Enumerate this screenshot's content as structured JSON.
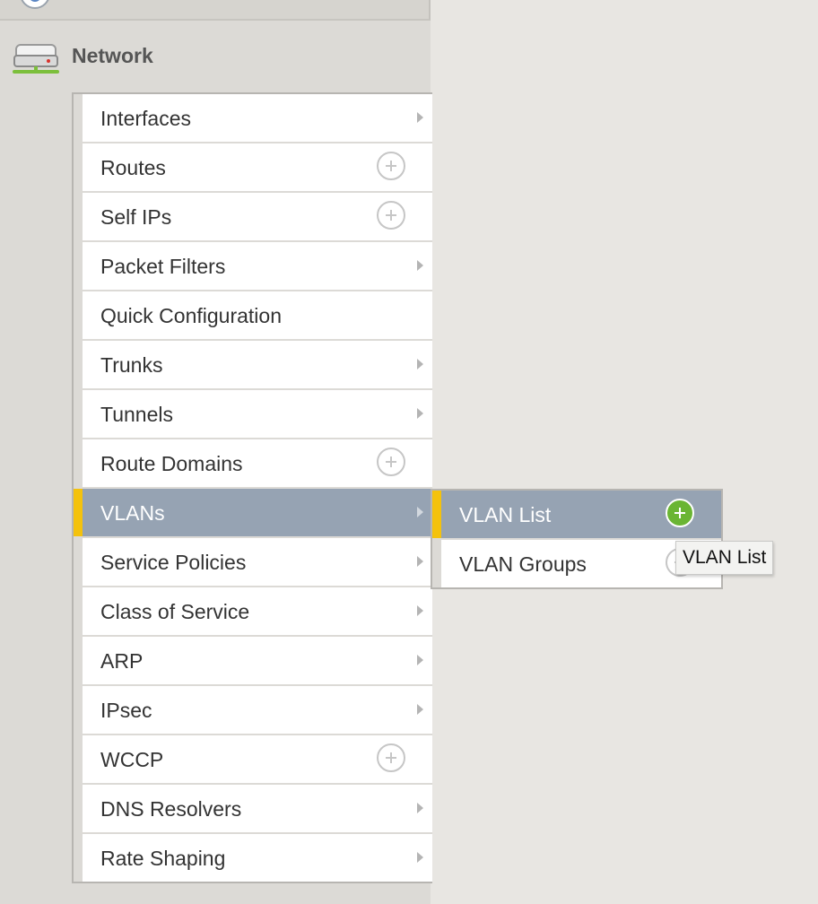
{
  "header": {
    "title": "Network",
    "icon": "network-device-icon"
  },
  "menu": {
    "items": [
      {
        "label": "Interfaces",
        "affordance": "arrow"
      },
      {
        "label": "Routes",
        "affordance": "plus"
      },
      {
        "label": "Self IPs",
        "affordance": "plus"
      },
      {
        "label": "Packet Filters",
        "affordance": "arrow"
      },
      {
        "label": "Quick Configuration",
        "affordance": "none"
      },
      {
        "label": "Trunks",
        "affordance": "arrow"
      },
      {
        "label": "Tunnels",
        "affordance": "arrow"
      },
      {
        "label": "Route Domains",
        "affordance": "plus"
      },
      {
        "label": "VLANs",
        "affordance": "arrow",
        "selected": true
      },
      {
        "label": "Service Policies",
        "affordance": "arrow"
      },
      {
        "label": "Class of Service",
        "affordance": "arrow"
      },
      {
        "label": "ARP",
        "affordance": "arrow"
      },
      {
        "label": "IPsec",
        "affordance": "arrow"
      },
      {
        "label": "WCCP",
        "affordance": "plus"
      },
      {
        "label": "DNS Resolvers",
        "affordance": "arrow"
      },
      {
        "label": "Rate Shaping",
        "affordance": "arrow"
      }
    ]
  },
  "submenu": {
    "items": [
      {
        "label": "VLAN List",
        "affordance": "plus",
        "selected": true
      },
      {
        "label": "VLAN Groups",
        "affordance": "plus"
      }
    ]
  },
  "tooltip": {
    "text": "VLAN List"
  },
  "colors": {
    "selected_background": "#96a3b3",
    "selected_accent": "#f4c20d",
    "add_button_active": "#6ab533",
    "panel_background": "#dcdad6"
  }
}
